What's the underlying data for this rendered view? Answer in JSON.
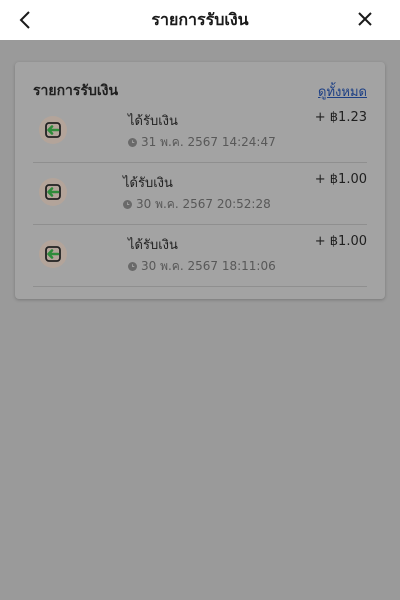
{
  "header": {
    "title": "รายการรับเงิน"
  },
  "card": {
    "title": "รายการรับเงิน",
    "view_all": "ดูทั้งหมด"
  },
  "transactions": [
    {
      "title": "ได้รับเงิน",
      "amount": "+ ฿1.23",
      "time": "31 พ.ค. 2567 14:24:47"
    },
    {
      "title": "ได้รับเงิน",
      "amount": "+ ฿1.00",
      "time": "30 พ.ค. 2567 20:52:28"
    },
    {
      "title": "ได้รับเงิน",
      "amount": "+ ฿1.00",
      "time": "30 พ.ค. 2567 18:11:06"
    }
  ],
  "icons": {
    "back": "back-icon",
    "close": "close-icon",
    "receive": "receive-money-icon",
    "clock": "clock-icon"
  },
  "colors": {
    "overlay": "#9a9a9a",
    "card": "#a3a3a3",
    "link": "#1c3f85",
    "receive_arrow": "#2e8b3a"
  }
}
